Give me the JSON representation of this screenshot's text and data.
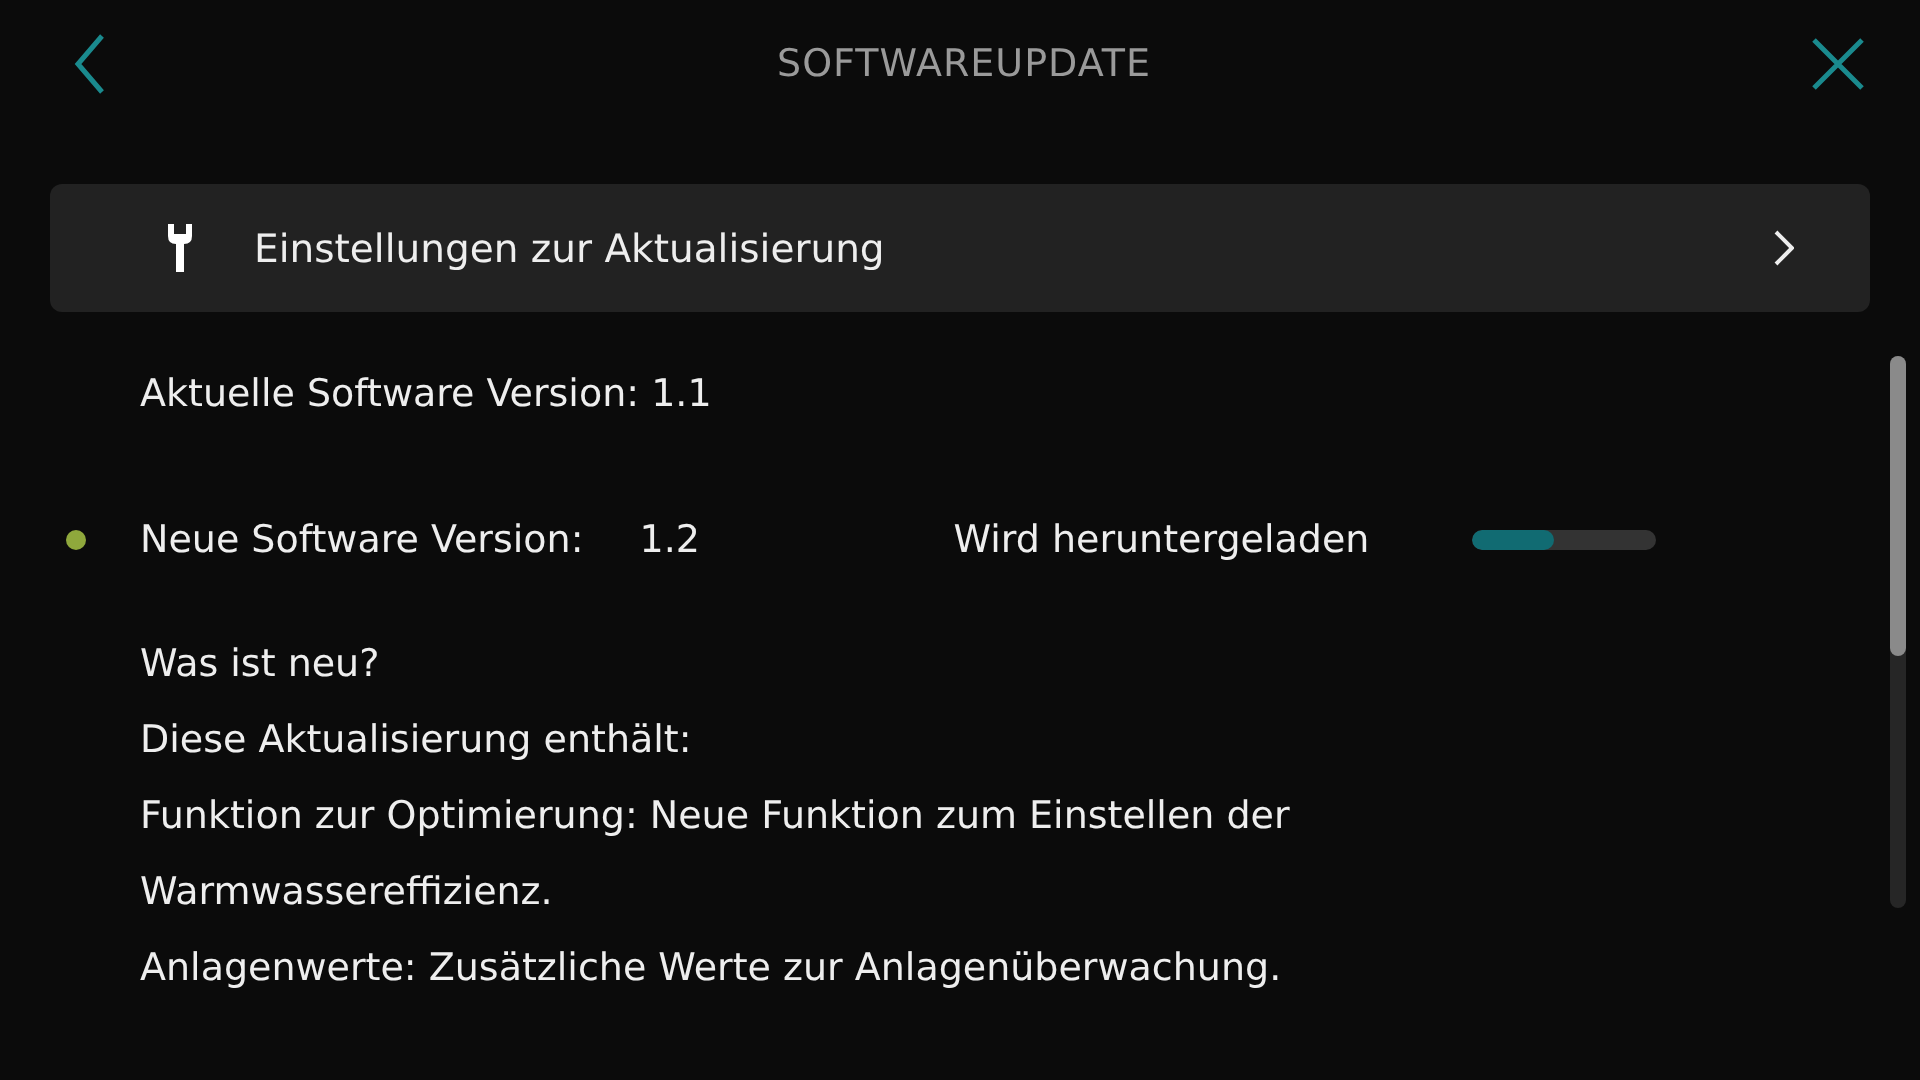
{
  "header": {
    "title": "SOFTWAREUPDATE"
  },
  "settings_row": {
    "label": "Einstellungen zur Aktualisierung"
  },
  "current_version": "Aktuelle Software Version: 1.1",
  "new_version": {
    "label": "Neue Software Version:",
    "value": "1.2",
    "status": "Wird heruntergeladen",
    "color": "#8fa83c",
    "level": 0.45
  },
  "notes": [
    "Was ist neu?",
    "Diese Aktualisierung enthält:",
    "Funktion zur Optimierung: Neue Funktion zum Einstellen der Warmwassereffizienz.",
    "Anlagenwerte: Zusätzliche Werte zur Anlagenüberwachung."
  ]
}
